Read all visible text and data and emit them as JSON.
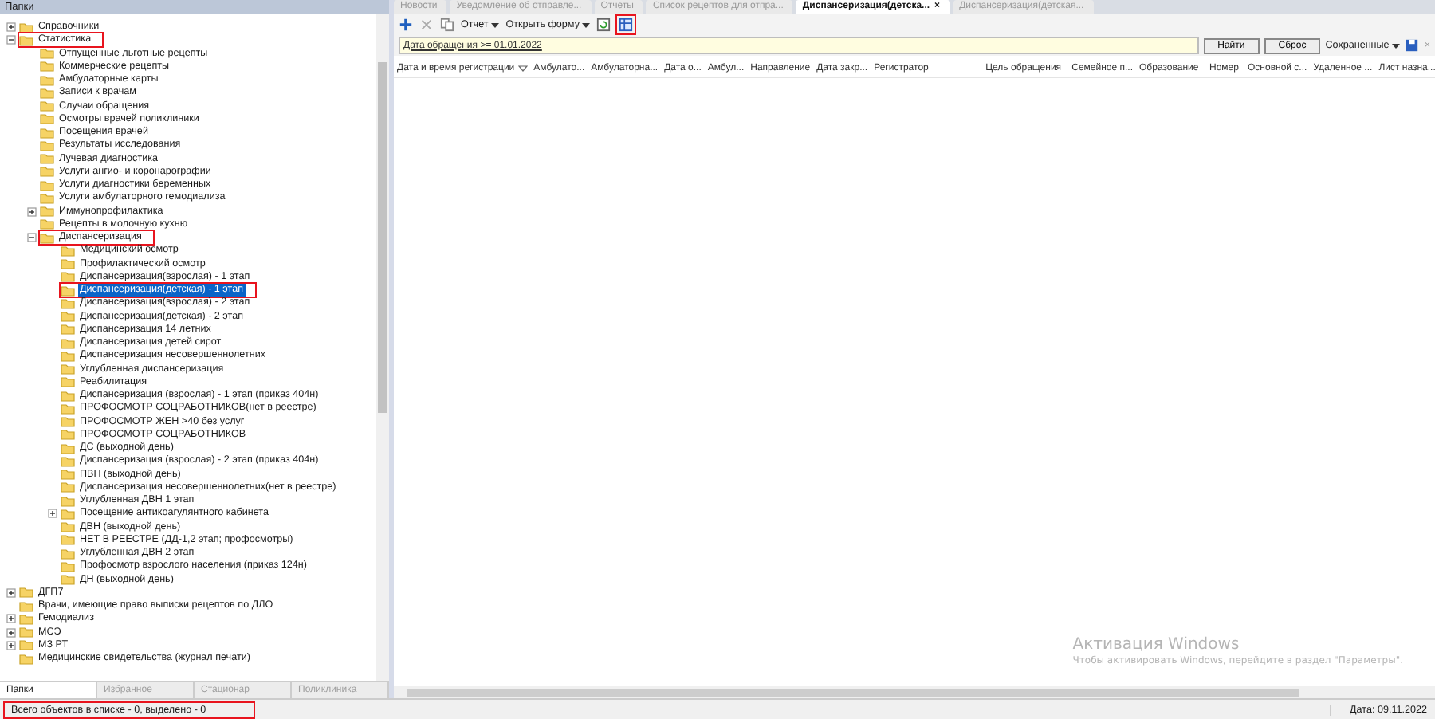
{
  "folders_panel": {
    "title": "Папки",
    "tree": [
      {
        "label": "Справочники",
        "expanded": false,
        "selected": false,
        "marked": false
      },
      {
        "label": "Статистика",
        "expanded": true,
        "selected": false,
        "marked": true,
        "children": [
          {
            "label": "Отпущенные льготные рецепты",
            "selected": false,
            "marked": false
          },
          {
            "label": "Коммерческие рецепты",
            "selected": false,
            "marked": false
          },
          {
            "label": "Амбулаторные карты",
            "selected": false,
            "marked": false
          },
          {
            "label": "Записи к врачам",
            "selected": false,
            "marked": false
          },
          {
            "label": "Случаи обращения",
            "selected": false,
            "marked": false
          },
          {
            "label": "Осмотры врачей поликлиники",
            "selected": false,
            "marked": false
          },
          {
            "label": "Посещения врачей",
            "selected": false,
            "marked": false
          },
          {
            "label": "Результаты исследования",
            "selected": false,
            "marked": false
          },
          {
            "label": "Лучевая диагностика",
            "selected": false,
            "marked": false
          },
          {
            "label": "Услуги ангио- и коронарографии",
            "selected": false,
            "marked": false
          },
          {
            "label": "Услуги диагностики беременных",
            "selected": false,
            "marked": false
          },
          {
            "label": "Услуги амбулаторного гемодиализа",
            "selected": false,
            "marked": false
          },
          {
            "label": "Иммунопрофилактика",
            "expanded": false,
            "selected": false,
            "marked": false
          },
          {
            "label": "Рецепты в молочную кухню",
            "selected": false,
            "marked": false
          },
          {
            "label": "Диспансеризация",
            "expanded": true,
            "selected": false,
            "marked": true,
            "children": [
              {
                "label": "Медицинский осмотр",
                "selected": false,
                "marked": false
              },
              {
                "label": "Профилактический осмотр",
                "selected": false,
                "marked": false
              },
              {
                "label": "Диспансеризация(взрослая) - 1 этап",
                "selected": false,
                "marked": false
              },
              {
                "label": "Диспансеризация(детская) - 1 этап",
                "selected": true,
                "marked": true
              },
              {
                "label": "Диспансеризация(взрослая) - 2 этап",
                "selected": false,
                "marked": false
              },
              {
                "label": "Диспансеризация(детская) - 2 этап",
                "selected": false,
                "marked": false
              },
              {
                "label": "Диспансеризация 14 летних",
                "selected": false,
                "marked": false
              },
              {
                "label": "Диспансеризация детей сирот",
                "selected": false,
                "marked": false
              },
              {
                "label": "Диспансеризация несовершеннолетних",
                "selected": false,
                "marked": false
              },
              {
                "label": "Углубленная диспансеризация",
                "selected": false,
                "marked": false
              },
              {
                "label": "Реабилитация",
                "selected": false,
                "marked": false
              },
              {
                "label": "Диспансеризация (взрослая) - 1 этап (приказ 404н)",
                "selected": false,
                "marked": false
              },
              {
                "label": "ПРОФОСМОТР СОЦРАБОТНИКОВ(нет в реестре)",
                "selected": false,
                "marked": false
              },
              {
                "label": "ПРОФОСМОТР ЖЕН >40 без услуг",
                "selected": false,
                "marked": false
              },
              {
                "label": "ПРОФОСМОТР СОЦРАБОТНИКОВ",
                "selected": false,
                "marked": false
              },
              {
                "label": "ДС (выходной день)",
                "selected": false,
                "marked": false
              },
              {
                "label": "Диспансеризация (взрослая) - 2 этап (приказ 404н)",
                "selected": false,
                "marked": false
              },
              {
                "label": "ПВН (выходной день)",
                "selected": false,
                "marked": false
              },
              {
                "label": "Диспансеризация несовершеннолетних(нет в реестре)",
                "selected": false,
                "marked": false
              },
              {
                "label": "Углубленная ДВН 1 этап",
                "selected": false,
                "marked": false
              },
              {
                "label": "Посещение антикоагулянтного кабинета",
                "expanded": false,
                "selected": false,
                "marked": false
              },
              {
                "label": "ДВН (выходной день)",
                "selected": false,
                "marked": false
              },
              {
                "label": "НЕТ В РЕЕСТРЕ (ДД-1,2 этап; профосмотры)",
                "selected": false,
                "marked": false
              },
              {
                "label": "Углубленная ДВН 2 этап",
                "selected": false,
                "marked": false
              },
              {
                "label": "Профосмотр взрослого населения (приказ 124н)",
                "selected": false,
                "marked": false
              },
              {
                "label": "ДН (выходной день)",
                "selected": false,
                "marked": false
              }
            ]
          }
        ]
      },
      {
        "label": "ДГП7",
        "expanded": false,
        "selected": false,
        "marked": false
      },
      {
        "label": "Врачи, имеющие право выписки рецептов по ДЛО",
        "selected": false,
        "marked": false
      },
      {
        "label": "Гемодиализ",
        "expanded": false,
        "selected": false,
        "marked": false
      },
      {
        "label": "МСЭ",
        "expanded": false,
        "selected": false,
        "marked": false
      },
      {
        "label": "МЗ РТ",
        "expanded": false,
        "selected": false,
        "marked": false
      },
      {
        "label": "Медицинские свидетельства (журнал печати)",
        "selected": false,
        "marked": false
      }
    ],
    "bottom_tabs": [
      {
        "label": "Папки",
        "selected": true
      },
      {
        "label": "Избранное",
        "selected": false
      },
      {
        "label": "Стационар",
        "selected": false
      },
      {
        "label": "Поликлиника",
        "selected": false
      }
    ]
  },
  "doc_tabs": [
    {
      "label": "Новости",
      "selected": false
    },
    {
      "label": "Уведомление об отправле...",
      "selected": false
    },
    {
      "label": "Отчеты",
      "selected": false
    },
    {
      "label": "Список рецептов для отпра...",
      "selected": false
    },
    {
      "label": "Диспансеризация(детска...",
      "selected": true,
      "close": "×"
    },
    {
      "label": "Диспансеризация(детская...",
      "selected": false
    }
  ],
  "toolbar": {
    "report": "Отчет",
    "open_form": "Открыть форму",
    "marked_button": true
  },
  "filter": {
    "condition": "Дата обращения >= 01.01.2022",
    "find": "Найти",
    "reset": "Сброс",
    "saved": "Сохраненные",
    "close": "×"
  },
  "table": {
    "columns": [
      {
        "label": "Дата и время регистрации",
        "sorted": true
      },
      {
        "label": "Амбулато...",
        "sorted": false
      },
      {
        "label": "Амбулаторна...",
        "sorted": false
      },
      {
        "label": "Дата о...",
        "sorted": false
      },
      {
        "label": "Амбул...",
        "sorted": false
      },
      {
        "label": "Направление",
        "sorted": false
      },
      {
        "label": "Дата закр...",
        "sorted": false
      },
      {
        "label": "Регистратор",
        "sorted": false
      },
      {
        "label": "Цель обращения",
        "sorted": false
      },
      {
        "label": "Семейное п...",
        "sorted": false
      },
      {
        "label": "Образование",
        "sorted": false
      },
      {
        "label": "Номер",
        "sorted": false
      },
      {
        "label": "Основной с...",
        "sorted": false
      },
      {
        "label": "Удаленное ...",
        "sorted": false
      },
      {
        "label": "Лист назна...",
        "sorted": false
      }
    ]
  },
  "status_bar": {
    "summary": "Всего объектов в списке - 0, выделено - 0",
    "summary_marked": true,
    "date": "Дата: 09.11.2022"
  },
  "os_notice": {
    "title": "Активация Windows",
    "text": "Чтобы активировать Windows, перейдите в раздел \"Параметры\"."
  }
}
